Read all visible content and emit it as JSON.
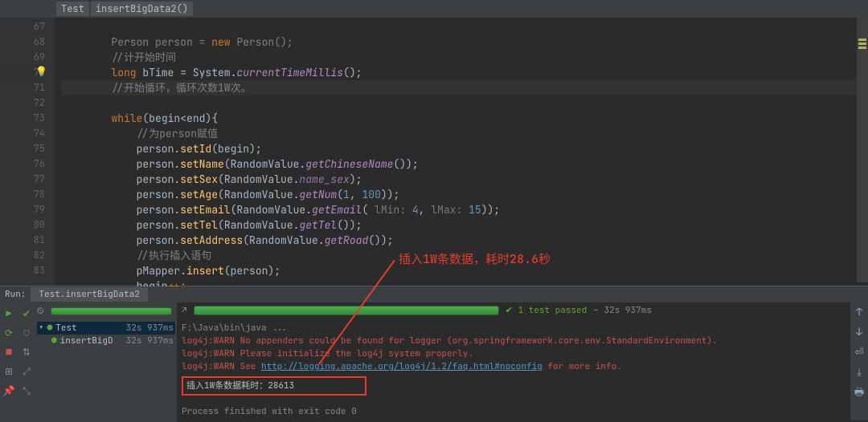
{
  "breadcrumb": {
    "a": "Test",
    "b": "insertBigData2()"
  },
  "lines": {
    "l1": "        Person person = new Person();",
    "l68": "        //计开始时间",
    "l69a": "        ",
    "l69k": "long",
    "l69b": " bTime = System.",
    "l69m": "currentTimeMillis",
    "l69c": "();",
    "l70": "        //开始循环，循环次数1W次。",
    "l71a": "        ",
    "l71k": "while",
    "l71b": "(begin<end){",
    "l72": "            //为person赋值",
    "l73a": "            person.",
    "l73m": "setId",
    "l73b": "(begin);",
    "l74a": "            person.",
    "l74m": "setName",
    "l74b": "(RandomValue.",
    "l74i": "getChineseName",
    "l74c": "());",
    "l75a": "            person.",
    "l75m": "setSex",
    "l75b": "(RandomValue.",
    "l75i": "name_sex",
    "l75c": ");",
    "l76a": "            person.",
    "l76m": "setAge",
    "l76b": "(RandomValue.",
    "l76i": "getNum",
    "l76c": "(",
    "l76n1": "1",
    "l76d": ", ",
    "l76n2": "100",
    "l76e": "));",
    "l77a": "            person.",
    "l77m": "setEmail",
    "l77b": "(RandomValue.",
    "l77i": "getEmail",
    "l77c": "( ",
    "l77p1": "lMin: ",
    "l77n1": "4",
    "l77d": ", ",
    "l77p2": "lMax: ",
    "l77n2": "15",
    "l77e": "));",
    "l78a": "            person.",
    "l78m": "setTel",
    "l78b": "(RandomValue.",
    "l78i": "getTel",
    "l78c": "());",
    "l79a": "            person.",
    "l79m": "setAddress",
    "l79b": "(RandomValue.",
    "l79i": "getRoad",
    "l79c": "());",
    "l80": "            //执行插入语句",
    "l81a": "            pMapper.",
    "l81m": "insert",
    "l81b": "(person);",
    "l82a": "            begin",
    "l82b": "++;",
    "l83": "        }"
  },
  "annotation": "插入1W条数据，耗时28.6秒",
  "run": {
    "title": "Run:",
    "tab": "Test.insertBigData2",
    "passed": "1 test passed",
    "elapsed": "– 32s 937ms",
    "rows": [
      {
        "label": "Test",
        "time": "32s 937ms"
      },
      {
        "label": "insertBigD",
        "time": "32s 937ms"
      }
    ]
  },
  "output": {
    "l1": "F:\\Java\\bin\\java ...",
    "l2": "log4j:WARN No appenders could be found for logger (org.springframework.core.env.StandardEnvironment).",
    "l3": "log4j:WARN Please initialize the log4j system properly.",
    "l4a": "log4j:WARN See ",
    "l4b": "http://logging.apache.org/log4j/1.2/faq.html#noconfig",
    "l4c": " for more info.",
    "l5": "插入1W条数据耗时：28613",
    "l6": "Process finished with exit code 0"
  },
  "gutter": [
    "67",
    "68",
    "69",
    "70",
    "71",
    "72",
    "73",
    "74",
    "75",
    "76",
    "77",
    "78",
    "79",
    "80",
    "81",
    "82",
    "83"
  ]
}
